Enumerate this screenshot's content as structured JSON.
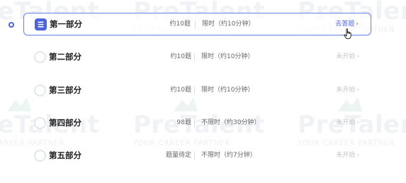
{
  "watermark": {
    "title": "PreTalent",
    "subtitle": "YOUR CAREER PARTNER"
  },
  "sections": [
    {
      "name": "第一部分",
      "count": "约10题",
      "time": "限时（约10分钟）",
      "action": "去答题",
      "state": "active"
    },
    {
      "name": "第二部分",
      "count": "约10题",
      "time": "限时（约10分钟）",
      "action": "未开始",
      "state": "pending"
    },
    {
      "name": "第三部分",
      "count": "约10题",
      "time": "限时（约10分钟）",
      "action": "未开始",
      "state": "pending"
    },
    {
      "name": "第四部分",
      "count": "98题",
      "time": "不限时（约30分钟）",
      "action": "未开始",
      "state": "pending"
    },
    {
      "name": "第五部分",
      "count": "题量待定",
      "time": "不限时（约7分钟）",
      "action": "未开始",
      "state": "pending"
    }
  ],
  "colors": {
    "accent": "#4d63d9",
    "border_active": "#6d82e6",
    "disabled_text": "#c3c6cc",
    "watermark": "#7884a0"
  },
  "icons": {
    "active_section": "list-document-icon",
    "pending_section": "empty-circle-icon",
    "action_arrow": "chevron-right-icon",
    "current_step": "step-ring-icon",
    "cursor": "hand-pointer-icon"
  }
}
